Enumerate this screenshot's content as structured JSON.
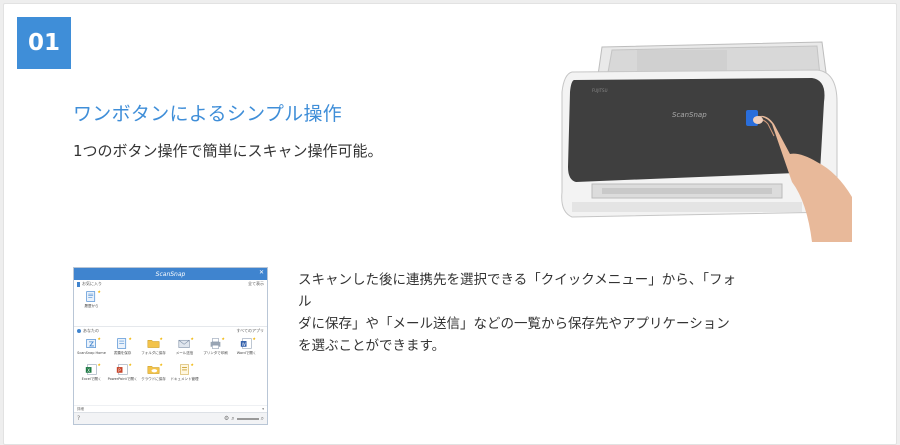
{
  "step": {
    "number": "01"
  },
  "feature": {
    "title": "ワンボタンによるシンプル操作",
    "subtitle": "1つのボタン操作で簡単にスキャン操作可能。"
  },
  "description": {
    "lines": [
      "スキャンした後に連携先を選択できる「クイックメニュー」から、「フォル",
      "ダに保存」や「メール送信」などの一覧から保存先やアプリケーション",
      "を選ぶことができます。"
    ]
  },
  "colors": {
    "accent": "#3f8ed8",
    "titlebar": "#3f84cf"
  },
  "scansnap_window": {
    "title": "ScanSnap",
    "close_icon": "close-icon",
    "favorites_label": "お気に入り",
    "favorites_action": "全て表示",
    "favorites_items": [
      {
        "label": "履歴から",
        "icon": "document-icon"
      }
    ],
    "apps_label": "あなたの",
    "apps_action": "すべてのアプリ",
    "apps_items": [
      {
        "label": "ScanSnap Home",
        "icon": "scansnap-icon"
      },
      {
        "label": "書類を保存",
        "icon": "document-icon"
      },
      {
        "label": "フォルダに保存",
        "icon": "folder-icon"
      },
      {
        "label": "メール送信",
        "icon": "mail-icon"
      },
      {
        "label": "プリンタで印刷",
        "icon": "printer-icon"
      },
      {
        "label": "Wordで開く",
        "icon": "word-icon"
      },
      {
        "label": "Excelで開く",
        "icon": "excel-icon"
      },
      {
        "label": "PowerPointで開く",
        "icon": "powerpoint-icon"
      },
      {
        "label": "クラウドに保存",
        "icon": "cloud-folder-icon"
      },
      {
        "label": "ドキュメント管理",
        "icon": "document-app-icon"
      }
    ],
    "footer_label": "詳細",
    "footer_action": "▾"
  }
}
